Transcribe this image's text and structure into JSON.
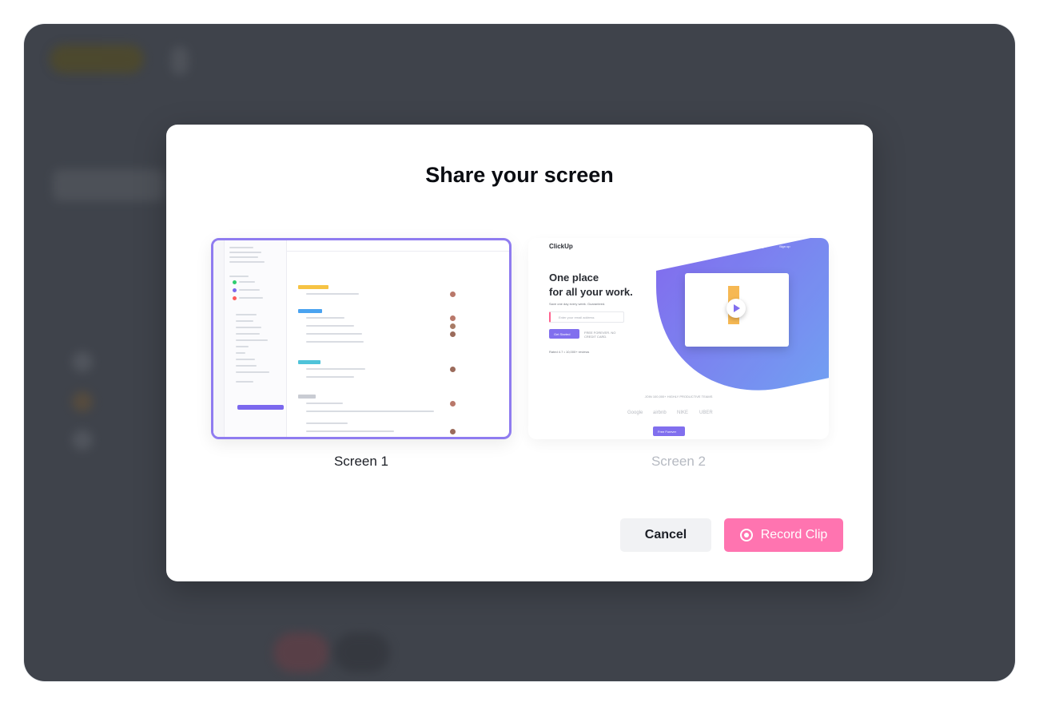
{
  "modal": {
    "title": "Share your screen",
    "cancel_label": "Cancel",
    "record_label": "Record Clip"
  },
  "screens": [
    {
      "label": "Screen 1",
      "selected": true
    },
    {
      "label": "Screen 2",
      "selected": false
    }
  ],
  "screen1_preview": {
    "sidebar_items": [
      "Favorites",
      "Spaces",
      "Sales",
      "ClickOps",
      "Marketing",
      "General",
      "Product",
      "Consultants",
      "Advertising",
      "User Onboarding",
      "SEO",
      "PR",
      "Events",
      "Branding",
      "Product Marketing",
      "People"
    ],
    "toolbar": [
      "Priority List",
      "List",
      "Board",
      "Calendar",
      "Gantt",
      "Box",
      "Activity",
      "Table"
    ],
    "task_groups": [
      {
        "status": "CREATED / TO DO",
        "tasks": [
          "Update ClickTips Thumbnails"
        ]
      },
      {
        "status": "IN PROGRESS",
        "tasks": [
          "Various dash updates",
          "ClickUp Blog/Guide Assets",
          "Update Flat Style Graphic Library",
          "Design SOP & Creative Process"
        ]
      },
      {
        "status": "REVIEW",
        "tasks": [
          "Update graphics on Features page",
          "Chrome graphic quality issue"
        ]
      },
      {
        "status": "DONE",
        "tasks": [
          "Billing progress modal",
          "Sharing improvements to streamline guests",
          "Add Time Estimates to tasks",
          "Create an updated component library for all UI elements"
        ]
      }
    ]
  },
  "screen2_preview": {
    "logo": "ClickUp",
    "nav": [
      "Product",
      "Learn",
      "Pricing",
      "Contact Sales",
      "Login",
      "Sign up"
    ],
    "headline_1": "One place",
    "headline_2": "for all your work.",
    "sub": "Save one day every week. Guaranteed.",
    "email_placeholder": "Enter your email address",
    "cta": "Get Started",
    "free_note": "FREE FOREVER. NO CREDIT CARD.",
    "rating": "Rated 4.7 • 10,000+ reviews",
    "join": "JOIN 100,000+ HIGHLY PRODUCTIVE TEAMS",
    "brands": [
      "Google",
      "airbnb",
      "NIKE",
      "UBER"
    ],
    "free_button": "Free Forever"
  },
  "colors": {
    "accent": "#8f7cf0",
    "record": "#ff74b0",
    "backdrop": "#3f434b"
  }
}
